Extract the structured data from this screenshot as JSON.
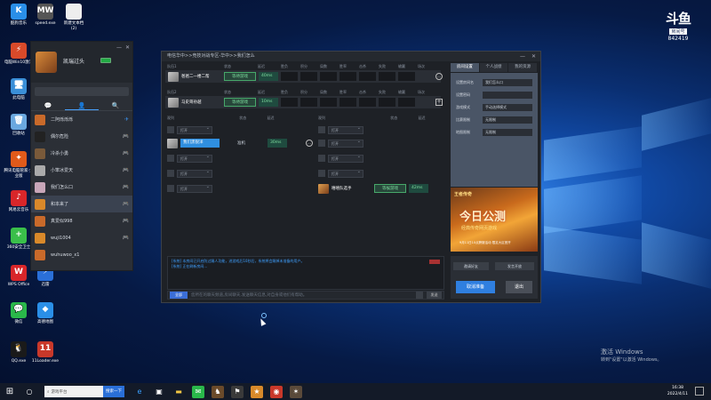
{
  "desktop_icons": [
    {
      "label": "酷狗音乐",
      "color": "#2a8fe8",
      "glyph": "K"
    },
    {
      "label": "speed.exe",
      "color": "#555555",
      "glyph": "MW"
    },
    {
      "label": "新建文本档\n(2)",
      "color": "#eeeeee",
      "glyph": ""
    },
    {
      "label": "电脑Win10激活",
      "color": "#d94a2a",
      "glyph": "⚡"
    },
    {
      "label": "此电脑",
      "color": "#3a8fd8",
      "glyph": "🖥"
    },
    {
      "label": "回收站",
      "color": "#6aa8e0",
      "glyph": "🗑"
    },
    {
      "label": "腾讯电脑管家·企业版",
      "color": "#e05a1a",
      "glyph": "✦"
    },
    {
      "label": "网易云音乐",
      "color": "#d9262a",
      "glyph": "♪"
    },
    {
      "label": "360安全卫士",
      "color": "#3abf4a",
      "glyph": "+"
    },
    {
      "label": "WPS Office",
      "color": "#d9262a",
      "glyph": "W"
    },
    {
      "label": "迅雷",
      "color": "#2a6fd8",
      "glyph": "⚡"
    },
    {
      "label": "微信",
      "color": "#2ab84a",
      "glyph": "💬"
    },
    {
      "label": "高德地图",
      "color": "#2a8fe8",
      "glyph": "◆"
    },
    {
      "label": "QQ.exe",
      "color": "#1a1a1a",
      "glyph": "🐧"
    },
    {
      "label": "11Loader.exe",
      "color": "#c9382a",
      "glyph": "11"
    }
  ],
  "friend_panel": {
    "username": "凯瑞过头",
    "tabs": [
      "💬",
      "👤",
      "🔍"
    ],
    "friends": [
      {
        "name": "二阿烁烁烁",
        "status": "✈",
        "color": "#c96a2a"
      },
      {
        "name": "偶尔危险",
        "status": "🎮",
        "color": "#222222"
      },
      {
        "name": "冷杀小勇",
        "status": "🎮",
        "color": "#7a5a3a"
      },
      {
        "name": "小笨冰爱天",
        "status": "🎮",
        "color": "#aaaaaa"
      },
      {
        "name": "我们怎么口",
        "status": "🎮",
        "color": "#c8a6b8"
      },
      {
        "name": "和本来了",
        "status": "🎮",
        "color": "#d9892a",
        "selected": true
      },
      {
        "name": "真爱似998",
        "status": "🎮",
        "color": "#c96a2a"
      },
      {
        "name": "wuji1004",
        "status": "🎮",
        "color": "#d9892a"
      },
      {
        "name": "wuhuwoo_x1",
        "status": "",
        "color": "#c96a2a"
      }
    ]
  },
  "main_window": {
    "breadcrumb": "电信华中>>竞技对战专区-华中>>我们怎么",
    "team_headers": [
      "状态",
      "延迟",
      "胜负",
      "积分",
      "局数",
      "胜率",
      "击杀",
      "失败",
      "输赢",
      "场次"
    ],
    "team1_label": "队伍1",
    "team2_label": "队伍2",
    "team1_player": {
      "name": "爸爸二一楼二帮",
      "status": "等待游戏",
      "ping": "40ms"
    },
    "team2_player": {
      "name": "马史哥孙越",
      "status": "等待游戏",
      "ping": "10ms"
    },
    "obs_header_left": [
      "观列",
      "状态",
      "延迟"
    ],
    "obs_header_right": [
      "观列",
      "状态",
      "延迟"
    ],
    "open_label": "打开",
    "left_obs_player": {
      "name": "我们黑锐洋",
      "status": "准机",
      "ping": "30ms"
    },
    "right_obs_player": {
      "name": "嘻嘻队选手",
      "status": "等候游戏",
      "ping": "42ms"
    },
    "chat_lines": [
      "[系统] 本房间已开启防过踢人功能，进游戏后10秒后，系统将会踢掉未准备的用户。",
      "[系统] 正在刷新房间..."
    ],
    "chat_channel": "全部",
    "chat_placeholder": "您所在的聊天频道,房间聊天,发送聊天信息,对自身或他们有帮助。",
    "send_label": "发送"
  },
  "room_settings": {
    "tabs": [
      "房间设置",
      "个人战绩",
      "我的资源"
    ],
    "rows": [
      {
        "label": "设置房间名",
        "value": "我们怎么口"
      },
      {
        "label": "设置密码",
        "value": ""
      },
      {
        "label": "游戏模式",
        "value": "手动选择模式"
      },
      {
        "label": "比赛限制",
        "value": "无限制"
      },
      {
        "label": "地图限制",
        "value": "无限制"
      }
    ]
  },
  "ad": {
    "logo": "王者传奇",
    "headline": "今日公测",
    "sub": "经典传奇网页游戏",
    "date": "9月11日10点跨服活动 限定大区首开"
  },
  "room_buttons": {
    "invite": "邀请好友",
    "voice": "发言开放",
    "ready": "取消准备",
    "quit": "退出"
  },
  "taskbar": {
    "search": "游戏平台",
    "search_btn": "搜索一下",
    "time": "16:38",
    "date": "2022/4/11"
  },
  "watermark": {
    "line1": "激活 Windows",
    "line2": "转到\"设置\"以激活 Windows。"
  },
  "brand": {
    "logo": "斗鱼",
    "tag": "房间号",
    "room_id": "842419"
  }
}
